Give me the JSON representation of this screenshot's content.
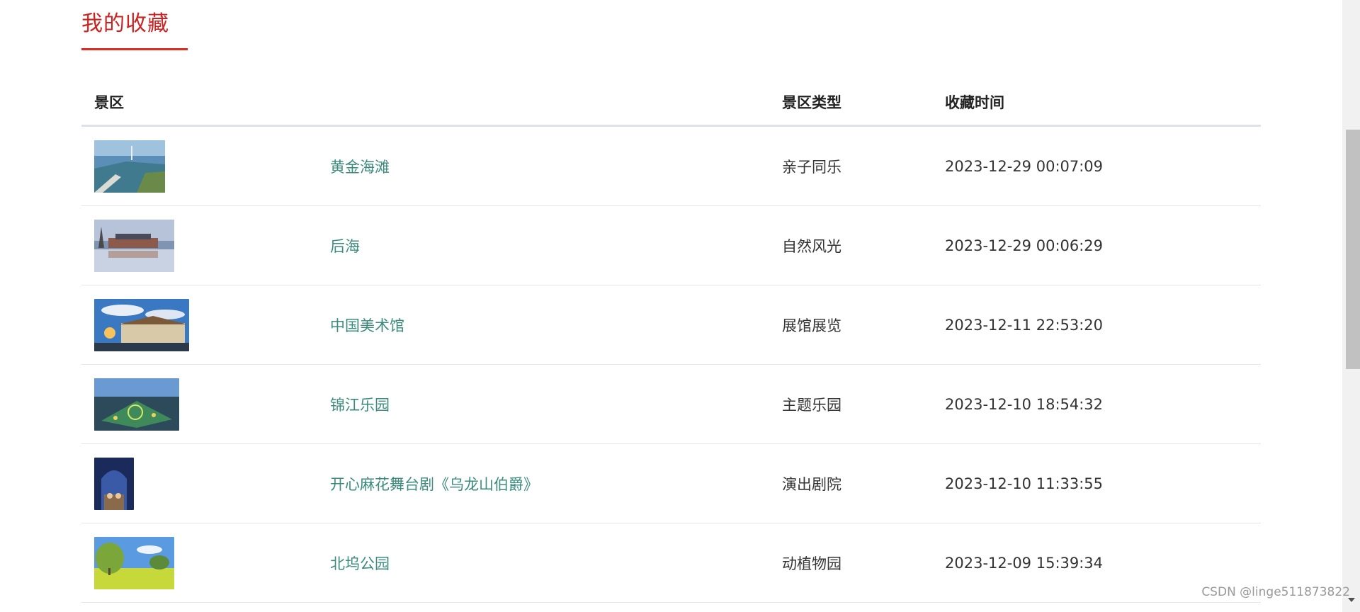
{
  "page": {
    "title": "我的收藏"
  },
  "table": {
    "headers": {
      "scenic": "景区",
      "type": "景区类型",
      "time": "收藏时间"
    },
    "rows": [
      {
        "name": "黄金海滩",
        "type": "亲子同乐",
        "time": "2023-12-29 00:07:09",
        "thumb": "coast-aerial-photo"
      },
      {
        "name": "后海",
        "type": "自然风光",
        "time": "2023-12-29 00:06:29",
        "thumb": "lake-reflection-photo"
      },
      {
        "name": "中国美术馆",
        "type": "展馆展览",
        "time": "2023-12-11 22:53:20",
        "thumb": "museum-building-photo"
      },
      {
        "name": "锦江乐园",
        "type": "主题乐园",
        "time": "2023-12-10 18:54:32",
        "thumb": "amusement-park-photo"
      },
      {
        "name": "开心麻花舞台剧《乌龙山伯爵》",
        "type": "演出剧院",
        "time": "2023-12-10 11:33:55",
        "thumb": "stage-show-photo"
      },
      {
        "name": "北坞公园",
        "type": "动植物园",
        "time": "2023-12-09 15:39:34",
        "thumb": "park-meadow-photo"
      }
    ]
  },
  "watermark": "CSDN @linge511873822",
  "colors": {
    "title": "#cc2222",
    "title_underline": "#e02a1e",
    "link": "#3b8b7e"
  }
}
